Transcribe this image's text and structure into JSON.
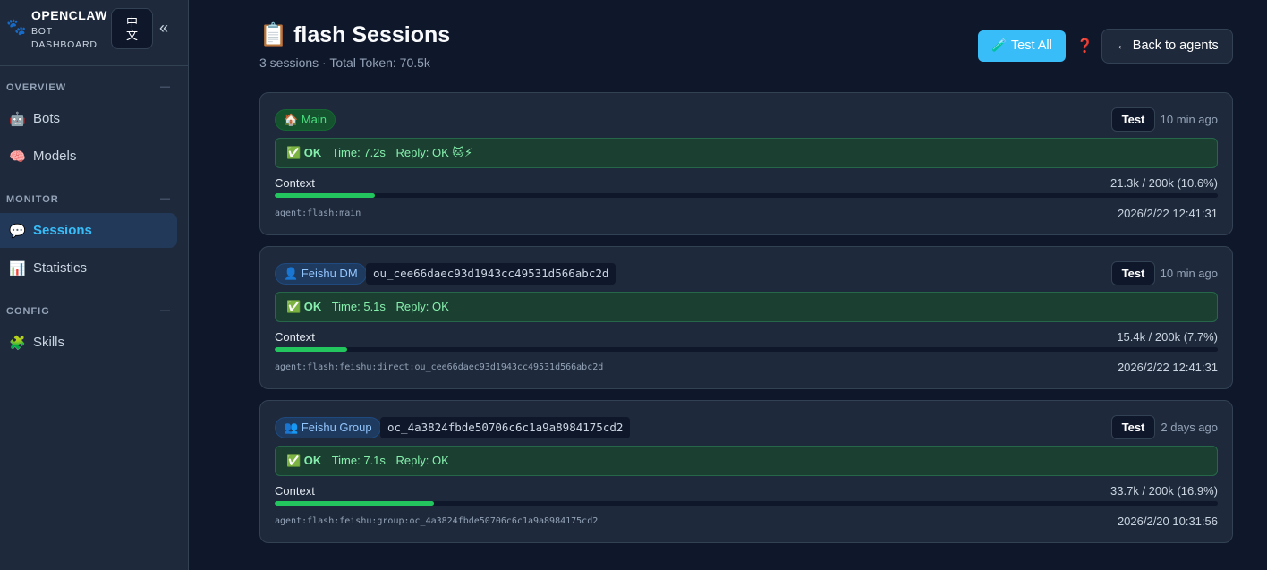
{
  "brand": {
    "title": "OPENCLAW",
    "subtitle": "BOT DASHBOARD",
    "lang_label": "中文",
    "collapse_glyph": "«"
  },
  "sidebar": {
    "sections": [
      {
        "label": "OVERVIEW",
        "items": [
          {
            "icon": "🤖",
            "label": "Bots"
          },
          {
            "icon": "🧠",
            "label": "Models"
          }
        ]
      },
      {
        "label": "MONITOR",
        "items": [
          {
            "icon": "💬",
            "label": "Sessions",
            "active": true
          },
          {
            "icon": "📊",
            "label": "Statistics"
          }
        ]
      },
      {
        "label": "CONFIG",
        "items": [
          {
            "icon": "🧩",
            "label": "Skills"
          }
        ]
      }
    ]
  },
  "header": {
    "title": "📋 flash Sessions",
    "subtitle": "3 sessions · Total Token: 70.5k",
    "test_all_label": "🧪 Test All",
    "help_glyph": "❓",
    "back_label": "← Back to agents"
  },
  "sessions": [
    {
      "type_label": "🏠 Main",
      "type_color": "green",
      "session_id": "",
      "test_label": "Test",
      "ago": "10 min ago",
      "status": "✅ OK",
      "time": "Time: 7.2s",
      "reply": "Reply: OK 🐱⚡",
      "context_label": "Context",
      "context_value": "21.3k / 200k (10.6%)",
      "context_fraction": 0.106,
      "key": "agent:flash:main",
      "timestamp": "2026/2/22 12:41:31"
    },
    {
      "type_label": "👤 Feishu DM",
      "type_color": "blue",
      "session_id": "ou_cee66daec93d1943cc49531d566abc2d",
      "test_label": "Test",
      "ago": "10 min ago",
      "status": "✅ OK",
      "time": "Time: 5.1s",
      "reply": "Reply: OK",
      "context_label": "Context",
      "context_value": "15.4k / 200k (7.7%)",
      "context_fraction": 0.077,
      "key": "agent:flash:feishu:direct:ou_cee66daec93d1943cc49531d566abc2d",
      "timestamp": "2026/2/22 12:41:31"
    },
    {
      "type_label": "👥 Feishu Group",
      "type_color": "blue",
      "session_id": "oc_4a3824fbde50706c6c1a9a8984175cd2",
      "test_label": "Test",
      "ago": "2 days ago",
      "status": "✅ OK",
      "time": "Time: 7.1s",
      "reply": "Reply: OK",
      "context_label": "Context",
      "context_value": "33.7k / 200k (16.9%)",
      "context_fraction": 0.169,
      "key": "agent:flash:feishu:group:oc_4a3824fbde50706c6c1a9a8984175cd2",
      "timestamp": "2026/2/20 10:31:56"
    }
  ],
  "colors": {
    "accent": "#38bdf8",
    "ok": "#22c55e",
    "bg": "#0f172a",
    "panel": "#1e293b"
  }
}
